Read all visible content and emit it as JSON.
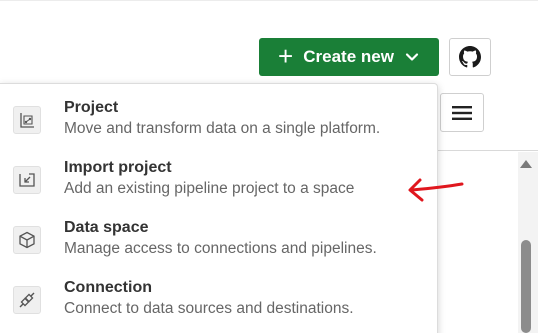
{
  "toolbar": {
    "create_label": "Create new",
    "create_icon": "plus-icon",
    "dropdown_icon": "chevron-down-icon",
    "github_icon": "github-icon",
    "view_icon": "list-view-icon",
    "accent": "#1a7f37"
  },
  "menu": {
    "items": [
      {
        "title": "Project",
        "description": "Move and transform data on a single platform.",
        "icon": "project-icon"
      },
      {
        "title": "Import project",
        "description": "Add an existing pipeline project to a space",
        "icon": "import-icon"
      },
      {
        "title": "Data space",
        "description": "Manage access to connections and pipelines.",
        "icon": "cube-icon"
      },
      {
        "title": "Connection",
        "description": "Connect to data sources and destinations.",
        "icon": "plug-icon"
      }
    ]
  },
  "annotation": {
    "color": "#e0171e",
    "shape": "arrow-pointing-left"
  }
}
